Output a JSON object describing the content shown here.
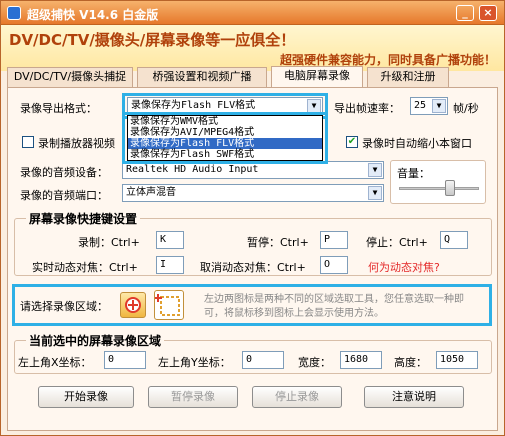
{
  "window": {
    "title": "超级捕快 V14.6 白金版",
    "minimize": "_",
    "close": "×"
  },
  "banner": {
    "slogan_main": "DV/DC/TV/摄像头/屏幕录像等一应俱全！",
    "slogan_sub": "超强硬件兼容能力，同时具备广播功能！"
  },
  "tabs": [
    {
      "label": "DV/DC/TV/摄像头捕捉"
    },
    {
      "label": "桥强设置和视频广播"
    },
    {
      "label": "电脑屏幕录像"
    },
    {
      "label": "升级和注册"
    }
  ],
  "export": {
    "format_label": "录像导出格式：",
    "format_value": "录像保存为Flash FLV格式",
    "options": [
      "录像保存为WMV格式",
      "录像保存为AVI/MPEG4格式",
      "录像保存为Flash FLV格式",
      "录像保存为Flash SWF格式"
    ],
    "fps_label": "导出帧速率：",
    "fps_value": "25",
    "fps_unit": "帧/秒"
  },
  "record_player": {
    "label": "录制播放器视频"
  },
  "auto_minimize": {
    "label": "录像时自动缩小本窗口",
    "checked": "✔"
  },
  "audio": {
    "device_label": "录像的音频设备：",
    "device_value": "Realtek HD Audio Input",
    "port_label": "录像的音频端口：",
    "port_value": "立体声混音",
    "volume_label": "音量："
  },
  "hotkeys": {
    "title": "屏幕录像快捷键设置",
    "record_label": "录制：Ctrl+",
    "record_key": "K",
    "pause_label": "暂停：Ctrl+",
    "pause_key": "P",
    "stop_label": "停止：Ctrl+",
    "stop_key": "Q",
    "track_label": "实时动态对焦：Ctrl+",
    "track_key": "I",
    "untrack_label": "取消动态对焦：Ctrl+",
    "untrack_key": "O",
    "what_is_link": "何为动态对焦?"
  },
  "region": {
    "label": "请选择录像区域：",
    "hint": "左边两图标是两种不同的区域选取工具，您任意选取一种即可，将鼠标移到图标上会显示使用方法。"
  },
  "current_region": {
    "title": "当前选中的屏幕录像区域",
    "x_label": "左上角X坐标：",
    "x_value": "0",
    "y_label": "左上角Y坐标：",
    "y_value": "0",
    "width_label": "宽度：",
    "width_value": "1680",
    "height_label": "高度：",
    "height_value": "1050"
  },
  "buttons": {
    "start": "开始录像",
    "pause": "暂停录像",
    "stop": "停止录像",
    "help": "注意说明"
  },
  "colors": {
    "highlight": "#2fb0e6",
    "title_orange": "#e6782b",
    "link_red": "#e42a2a"
  }
}
